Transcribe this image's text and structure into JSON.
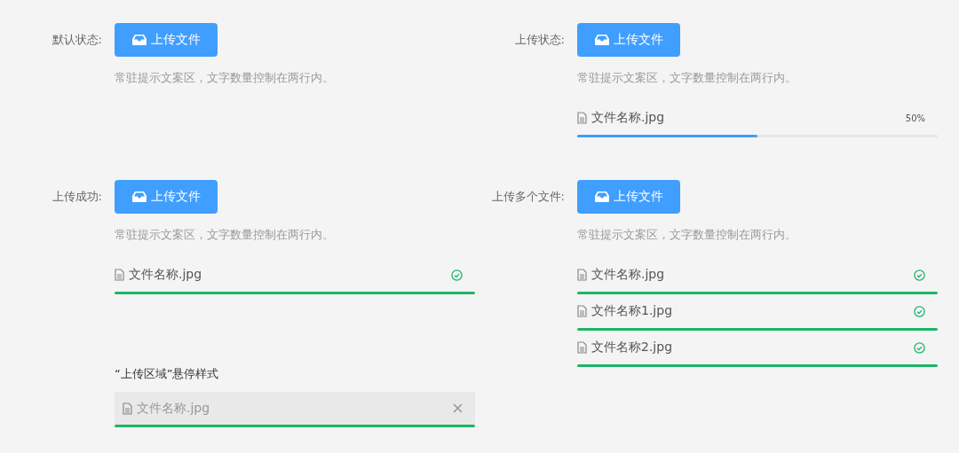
{
  "sections": [
    {
      "label": "默认状态:",
      "button": "上传文件",
      "hint": "常驻提示文案区，文字数量控制在两行内。"
    },
    {
      "label": "上传状态:",
      "button": "上传文件",
      "hint": "常驻提示文案区，文字数量控制在两行内。",
      "files": [
        {
          "name": "文件名称.jpg",
          "kind": "progress",
          "level": 0.5,
          "percent": "50%"
        }
      ]
    },
    {
      "label": "上传成功:",
      "button": "上传文件",
      "hint": "常驻提示文案区，文字数量控制在两行内。",
      "files": [
        {
          "name": "文件名称.jpg",
          "kind": "success"
        }
      ]
    },
    {
      "label": "上传多个文件:",
      "button": "上传文件",
      "hint": "常驻提示文案区，文字数量控制在两行内。",
      "files": [
        {
          "name": "文件名称.jpg",
          "kind": "success"
        },
        {
          "name": "文件名称1.jpg",
          "kind": "success"
        },
        {
          "name": "文件名称2.jpg",
          "kind": "success"
        }
      ]
    }
  ],
  "hover_demo": {
    "title": "“上传区域”悬停样式",
    "file": {
      "name": "文件名称.jpg",
      "kind": "hover"
    }
  }
}
